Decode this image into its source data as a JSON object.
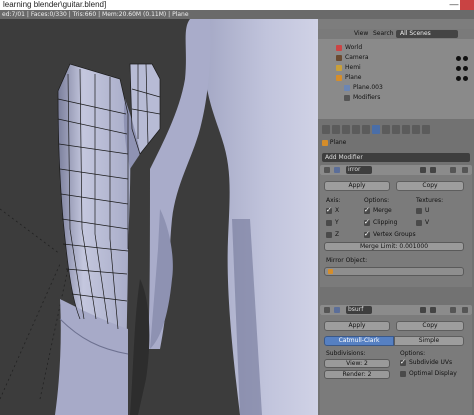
{
  "window": {
    "title": "learning blender\\guitar.blend]",
    "minimize_glyph": "—"
  },
  "info_bar": {
    "stats": "ed:7/01 | Faces:0/330 | Tris:660 | Mem:20.60M (0.11M) | Plane"
  },
  "outliner": {
    "view_label": "View",
    "search_label": "Search",
    "scenes_value": "All Scenes",
    "items": [
      {
        "label": "World",
        "icon": "world-icon"
      },
      {
        "label": "Camera",
        "icon": "camera-icon"
      },
      {
        "label": "Hemi",
        "icon": "lamp-icon"
      },
      {
        "label": "Plane",
        "icon": "mesh-object-icon"
      },
      {
        "label": "Plane.003",
        "icon": "mesh-data-icon"
      },
      {
        "label": "Modifiers",
        "icon": "wrench-icon"
      }
    ]
  },
  "properties": {
    "breadcrumb": "Plane",
    "add_modifier_label": "Add Modifier",
    "mirror": {
      "name_value": "irror",
      "apply_label": "Apply",
      "copy_label": "Copy",
      "axis_label": "Axis:",
      "options_label": "Options:",
      "textures_label": "Textures:",
      "axis_x": "X",
      "axis_y": "Y",
      "axis_z": "Z",
      "merge_label": "Merge",
      "clipping_label": "Clipping",
      "vertex_groups_label": "Vertex Groups",
      "tex_u": "U",
      "tex_v": "V",
      "merge_limit": "Merge Limit: 0.001000",
      "mirror_object_label": "Mirror Object:"
    },
    "subsurf": {
      "name_value": "bsurf",
      "apply_label": "Apply",
      "copy_label": "Copy",
      "catmull_label": "Catmull-Clark",
      "simple_label": "Simple",
      "subdivisions_label": "Subdivisions:",
      "options_label": "Options:",
      "view_value": "View: 2",
      "render_value": "Render: 2",
      "subdivide_uvs_label": "Subdivide UVs",
      "optimal_display_label": "Optimal Display"
    }
  },
  "colors": {
    "accent": "#5680c2",
    "viewport_bg": "#3c3c3c",
    "mesh_light": "#b9bcd6",
    "mesh_dark": "#8d91b3"
  }
}
